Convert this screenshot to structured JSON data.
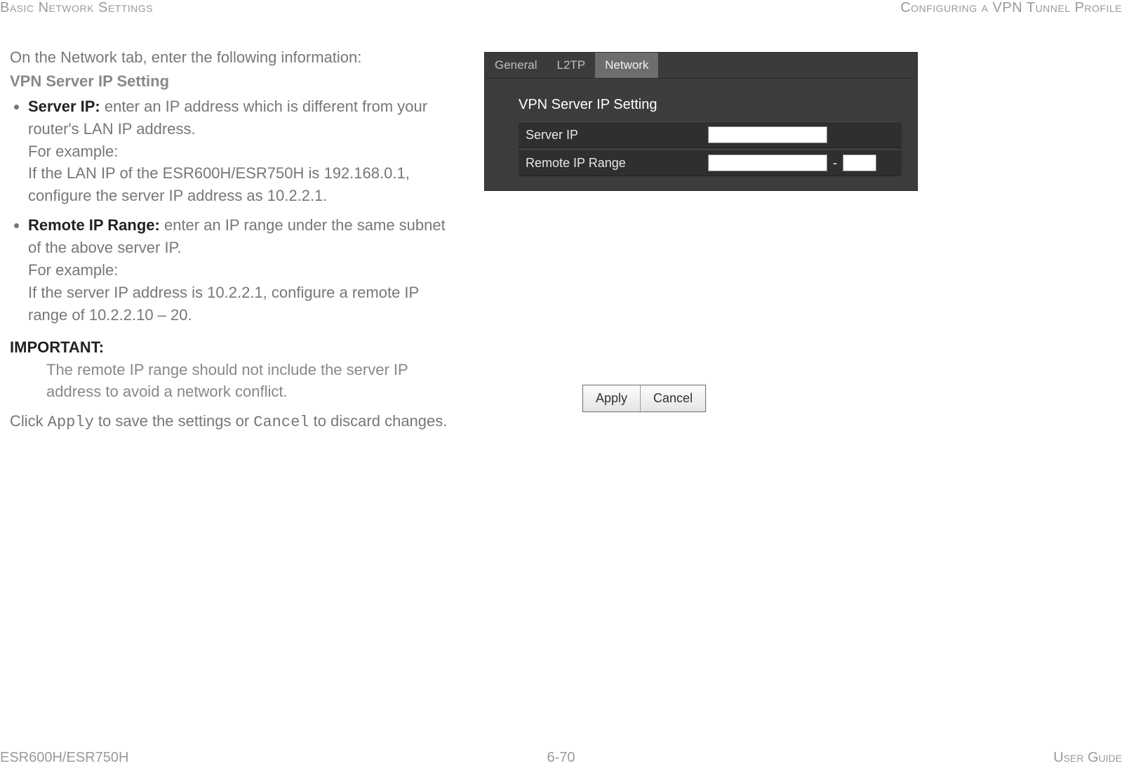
{
  "header": {
    "left": "Basic Network Settings",
    "right": "Configuring a VPN Tunnel Profile"
  },
  "footer": {
    "left": "ESR600H/ESR750H",
    "center": "6-70",
    "right": "User Guide"
  },
  "body": {
    "intro": "On the Network tab, enter the following information:",
    "section_head": "VPN Server IP Setting",
    "bullets": [
      {
        "label": "Server IP:",
        "text_after_label": " enter an IP address which is different from your router's LAN IP address.",
        "example_lead": "For example:",
        "example_body": "If the LAN IP of the ESR600H/ESR750H is 192.168.0.1, configure the server IP address as 10.2.2.1."
      },
      {
        "label": "Remote IP Range:",
        "text_after_label": " enter an IP range under the same subnet of the above server IP.",
        "example_lead": "For example:",
        "example_body": "If the server IP address is 10.2.2.1, configure a remote IP range of 10.2.2.10 – 20."
      }
    ],
    "important": {
      "label": "IMPORTANT:",
      "text": "The remote IP range should not include the server IP address to avoid a network conflict."
    },
    "click_line": {
      "pre": "Click ",
      "apply": "Apply",
      "mid": " to save the settings or ",
      "cancel": "Cancel",
      "post": " to discard changes."
    }
  },
  "screenshot_settings": {
    "tabs": [
      "General",
      "L2TP",
      "Network"
    ],
    "active_tab_index": 2,
    "title": "VPN Server IP Setting",
    "rows": {
      "server_ip_label": "Server IP",
      "remote_range_label": "Remote IP Range",
      "dash": "-"
    },
    "values": {
      "server_ip": "",
      "remote_start": "",
      "remote_end": ""
    }
  },
  "screenshot_buttons": {
    "apply": "Apply",
    "cancel": "Cancel"
  }
}
